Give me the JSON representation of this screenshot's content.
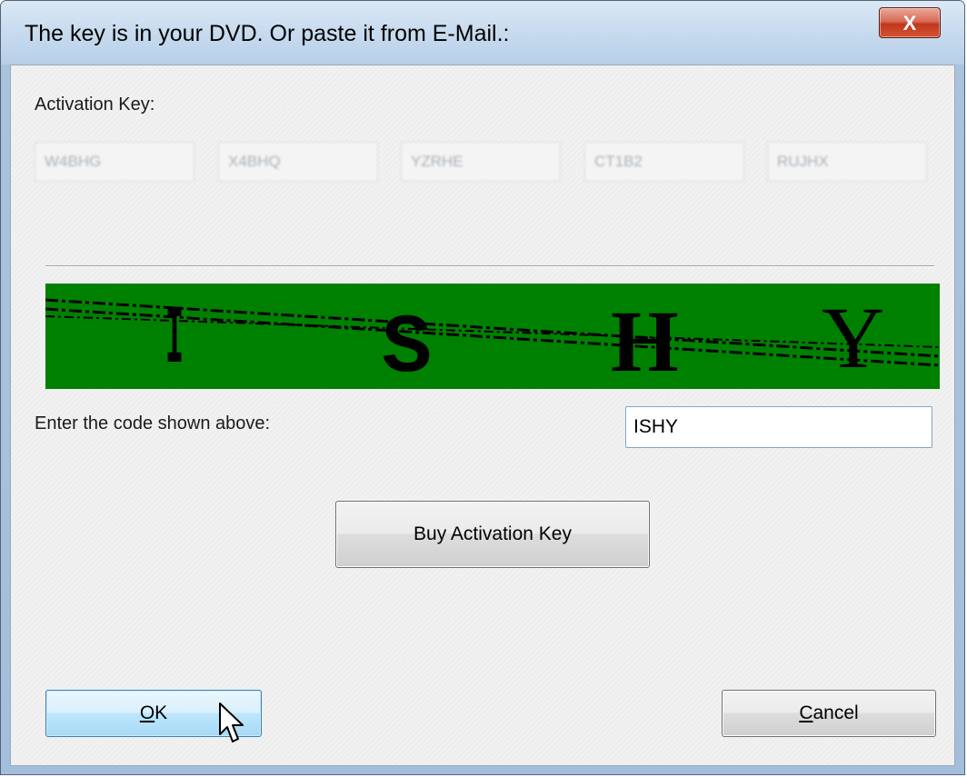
{
  "window": {
    "title": "The key is in your DVD. Or paste it from E-Mail.:",
    "close_label": "X"
  },
  "activation": {
    "label": "Activation Key:",
    "key_fields": [
      "W4BHG",
      "X4BHQ",
      "YZRHE",
      "CT1B2",
      "RUJHX"
    ]
  },
  "captcha": {
    "background_color": "#008000",
    "characters": [
      "I",
      "S",
      "H",
      "Y"
    ]
  },
  "code_entry": {
    "label": "Enter the code shown above:",
    "value": "ISHY"
  },
  "buttons": {
    "buy_label": "Buy Activation Key",
    "ok_mnemonic": "O",
    "ok_rest": "K",
    "cancel_mnemonic": "C",
    "cancel_rest": "ancel"
  }
}
